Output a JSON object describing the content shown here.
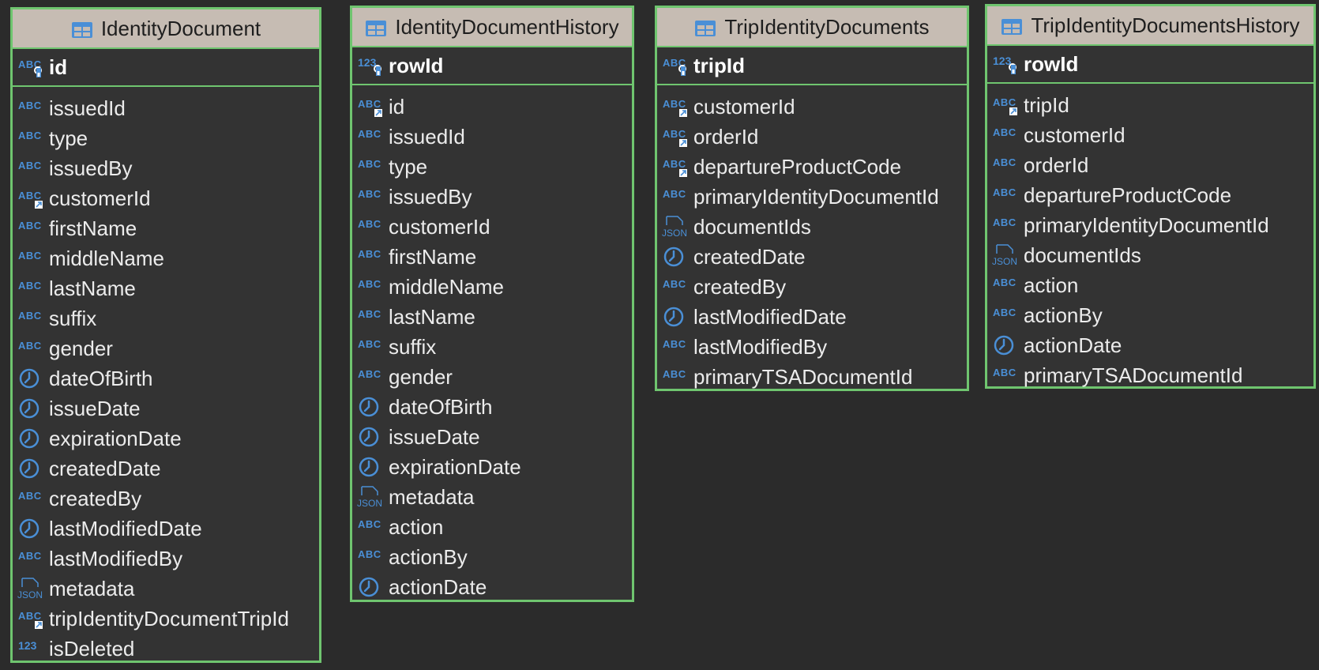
{
  "colors": {
    "background": "#2b2b2b",
    "panel": "#333333",
    "border": "#6fc56f",
    "header": "#c6bcb3",
    "icon": "#4a8fd6"
  },
  "entities": [
    {
      "title": "IdentityDocument",
      "pk": {
        "name": "id",
        "icon": "abc-key-icon"
      },
      "columns": [
        {
          "name": "issuedId",
          "icon": "abc-icon"
        },
        {
          "name": "type",
          "icon": "abc-icon"
        },
        {
          "name": "issuedBy",
          "icon": "abc-icon"
        },
        {
          "name": "customerId",
          "icon": "abc-fk-icon"
        },
        {
          "name": "firstName",
          "icon": "abc-icon"
        },
        {
          "name": "middleName",
          "icon": "abc-icon"
        },
        {
          "name": "lastName",
          "icon": "abc-icon"
        },
        {
          "name": "suffix",
          "icon": "abc-icon"
        },
        {
          "name": "gender",
          "icon": "abc-icon"
        },
        {
          "name": "dateOfBirth",
          "icon": "clock-icon"
        },
        {
          "name": "issueDate",
          "icon": "clock-icon"
        },
        {
          "name": "expirationDate",
          "icon": "clock-icon"
        },
        {
          "name": "createdDate",
          "icon": "clock-icon"
        },
        {
          "name": "createdBy",
          "icon": "abc-icon"
        },
        {
          "name": "lastModifiedDate",
          "icon": "clock-icon"
        },
        {
          "name": "lastModifiedBy",
          "icon": "abc-icon"
        },
        {
          "name": "metadata",
          "icon": "json-icon"
        },
        {
          "name": "tripIdentityDocumentTripId",
          "icon": "abc-fk-icon"
        },
        {
          "name": "isDeleted",
          "icon": "num-icon"
        }
      ]
    },
    {
      "title": "IdentityDocumentHistory",
      "pk": {
        "name": "rowId",
        "icon": "num-key-icon"
      },
      "columns": [
        {
          "name": "id",
          "icon": "abc-fk-icon"
        },
        {
          "name": "issuedId",
          "icon": "abc-icon"
        },
        {
          "name": "type",
          "icon": "abc-icon"
        },
        {
          "name": "issuedBy",
          "icon": "abc-icon"
        },
        {
          "name": "customerId",
          "icon": "abc-icon"
        },
        {
          "name": "firstName",
          "icon": "abc-icon"
        },
        {
          "name": "middleName",
          "icon": "abc-icon"
        },
        {
          "name": "lastName",
          "icon": "abc-icon"
        },
        {
          "name": "suffix",
          "icon": "abc-icon"
        },
        {
          "name": "gender",
          "icon": "abc-icon"
        },
        {
          "name": "dateOfBirth",
          "icon": "clock-icon"
        },
        {
          "name": "issueDate",
          "icon": "clock-icon"
        },
        {
          "name": "expirationDate",
          "icon": "clock-icon"
        },
        {
          "name": "metadata",
          "icon": "json-icon"
        },
        {
          "name": "action",
          "icon": "abc-icon"
        },
        {
          "name": "actionBy",
          "icon": "abc-icon"
        },
        {
          "name": "actionDate",
          "icon": "clock-icon"
        }
      ]
    },
    {
      "title": "TripIdentityDocuments",
      "pk": {
        "name": "tripId",
        "icon": "abc-key-icon"
      },
      "columns": [
        {
          "name": "customerId",
          "icon": "abc-fk-icon"
        },
        {
          "name": "orderId",
          "icon": "abc-fk-icon"
        },
        {
          "name": "departureProductCode",
          "icon": "abc-fk-icon"
        },
        {
          "name": "primaryIdentityDocumentId",
          "icon": "abc-icon"
        },
        {
          "name": "documentIds",
          "icon": "json-icon"
        },
        {
          "name": "createdDate",
          "icon": "clock-icon"
        },
        {
          "name": "createdBy",
          "icon": "abc-icon"
        },
        {
          "name": "lastModifiedDate",
          "icon": "clock-icon"
        },
        {
          "name": "lastModifiedBy",
          "icon": "abc-icon"
        },
        {
          "name": "primaryTSADocumentId",
          "icon": "abc-icon"
        }
      ]
    },
    {
      "title": "TripIdentityDocumentsHistory",
      "pk": {
        "name": "rowId",
        "icon": "num-key-icon"
      },
      "columns": [
        {
          "name": "tripId",
          "icon": "abc-fk-icon"
        },
        {
          "name": "customerId",
          "icon": "abc-icon"
        },
        {
          "name": "orderId",
          "icon": "abc-icon"
        },
        {
          "name": "departureProductCode",
          "icon": "abc-icon"
        },
        {
          "name": "primaryIdentityDocumentId",
          "icon": "abc-icon"
        },
        {
          "name": "documentIds",
          "icon": "json-icon"
        },
        {
          "name": "action",
          "icon": "abc-icon"
        },
        {
          "name": "actionBy",
          "icon": "abc-icon"
        },
        {
          "name": "actionDate",
          "icon": "clock-icon"
        },
        {
          "name": "primaryTSADocumentId",
          "icon": "abc-icon"
        }
      ]
    }
  ]
}
